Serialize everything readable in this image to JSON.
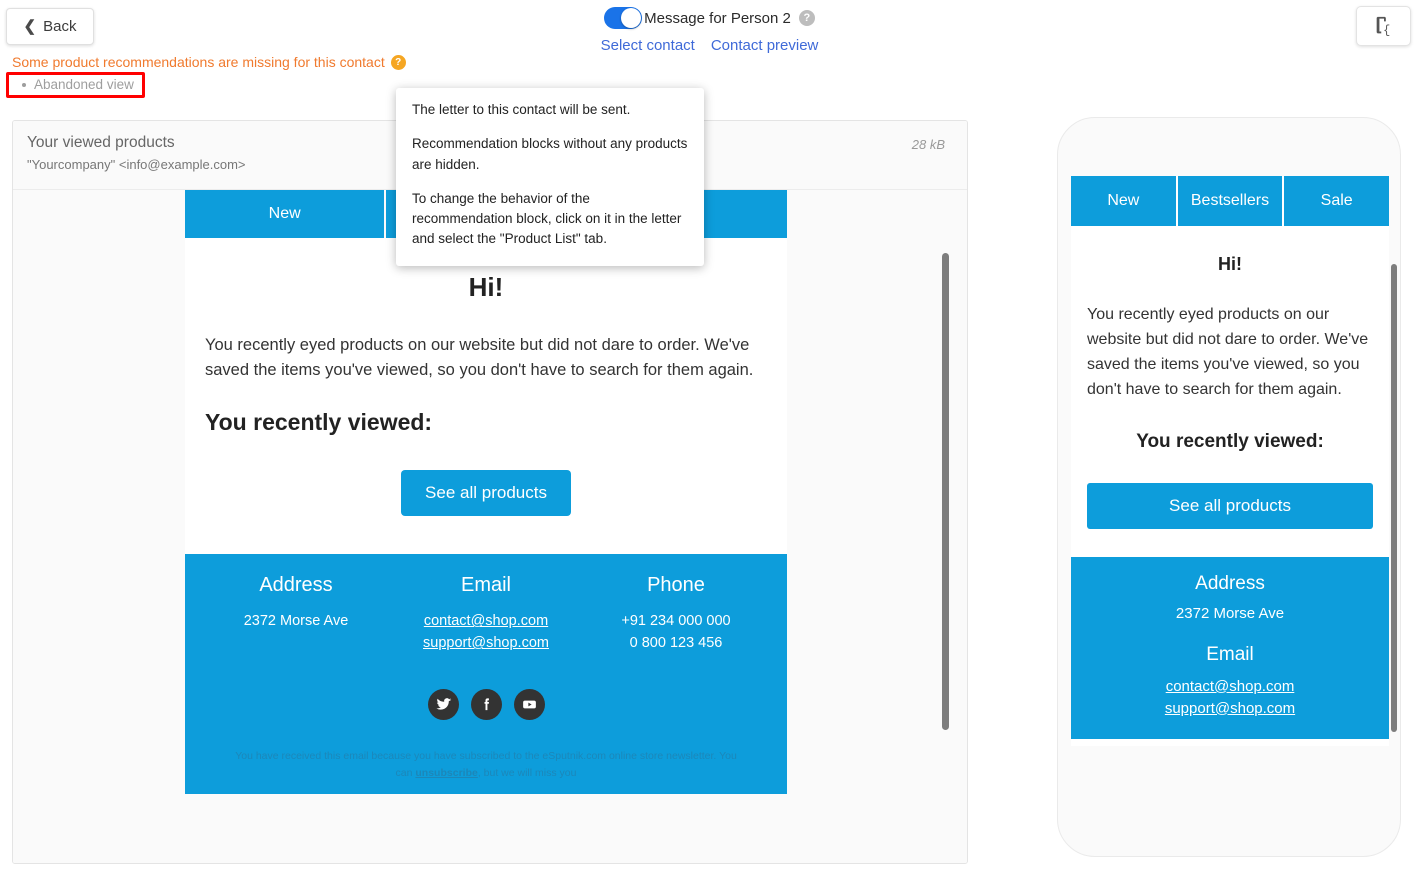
{
  "topbar": {
    "back_label": "Back",
    "back_chevron": "chevron-left-icon",
    "toggle_label": "Message for Person 2",
    "toggle_help": "?",
    "toggle_on": true,
    "select_contact": "Select contact",
    "contact_preview": "Contact preview",
    "code_icon": "code-file-icon"
  },
  "warning": {
    "text": "Some product recommendations are missing for this contact",
    "help": "?",
    "item": "Abandoned view",
    "highlight_color": "#ff0000",
    "text_color": "#f07a2e"
  },
  "tooltip": {
    "line1": "The letter to this contact will be sent.",
    "line2": "Recommendation blocks without any products are hidden.",
    "line3": "To change the behavior of the recommendation block, click on it in the letter and select the \"Product List\" tab."
  },
  "desktop": {
    "subject": "Your viewed products",
    "from": "\"Yourcompany\" <info@example.com>",
    "size": "28 kB"
  },
  "email": {
    "accent_color": "#0d9ddb",
    "tabs": [
      {
        "label": "New"
      },
      {
        "label": "Bestsellers"
      },
      {
        "label": "Sale"
      }
    ],
    "greeting": "Hi!",
    "paragraph": "You recently eyed products on our website but did not dare to order. We've saved the items you've viewed, so you don't have to search for them again.",
    "heading": "You recently viewed:",
    "cta": "See all products",
    "footer": {
      "address_title": "Address",
      "address_value": "2372 Morse Ave",
      "email_title": "Email",
      "email_1": "contact@shop.com",
      "email_2": "support@shop.com",
      "phone_title": "Phone",
      "phone_1": "+91 234 000 000",
      "phone_2": "0 800 123 456",
      "socials": [
        {
          "name": "twitter-icon"
        },
        {
          "name": "facebook-icon"
        },
        {
          "name": "youtube-icon"
        }
      ],
      "legal_before": "You have received this email because you have subscribed to the eSputnik.com online store newsletter. You can ",
      "legal_link": "unsubscribe",
      "legal_after": ", but we will miss you"
    }
  }
}
